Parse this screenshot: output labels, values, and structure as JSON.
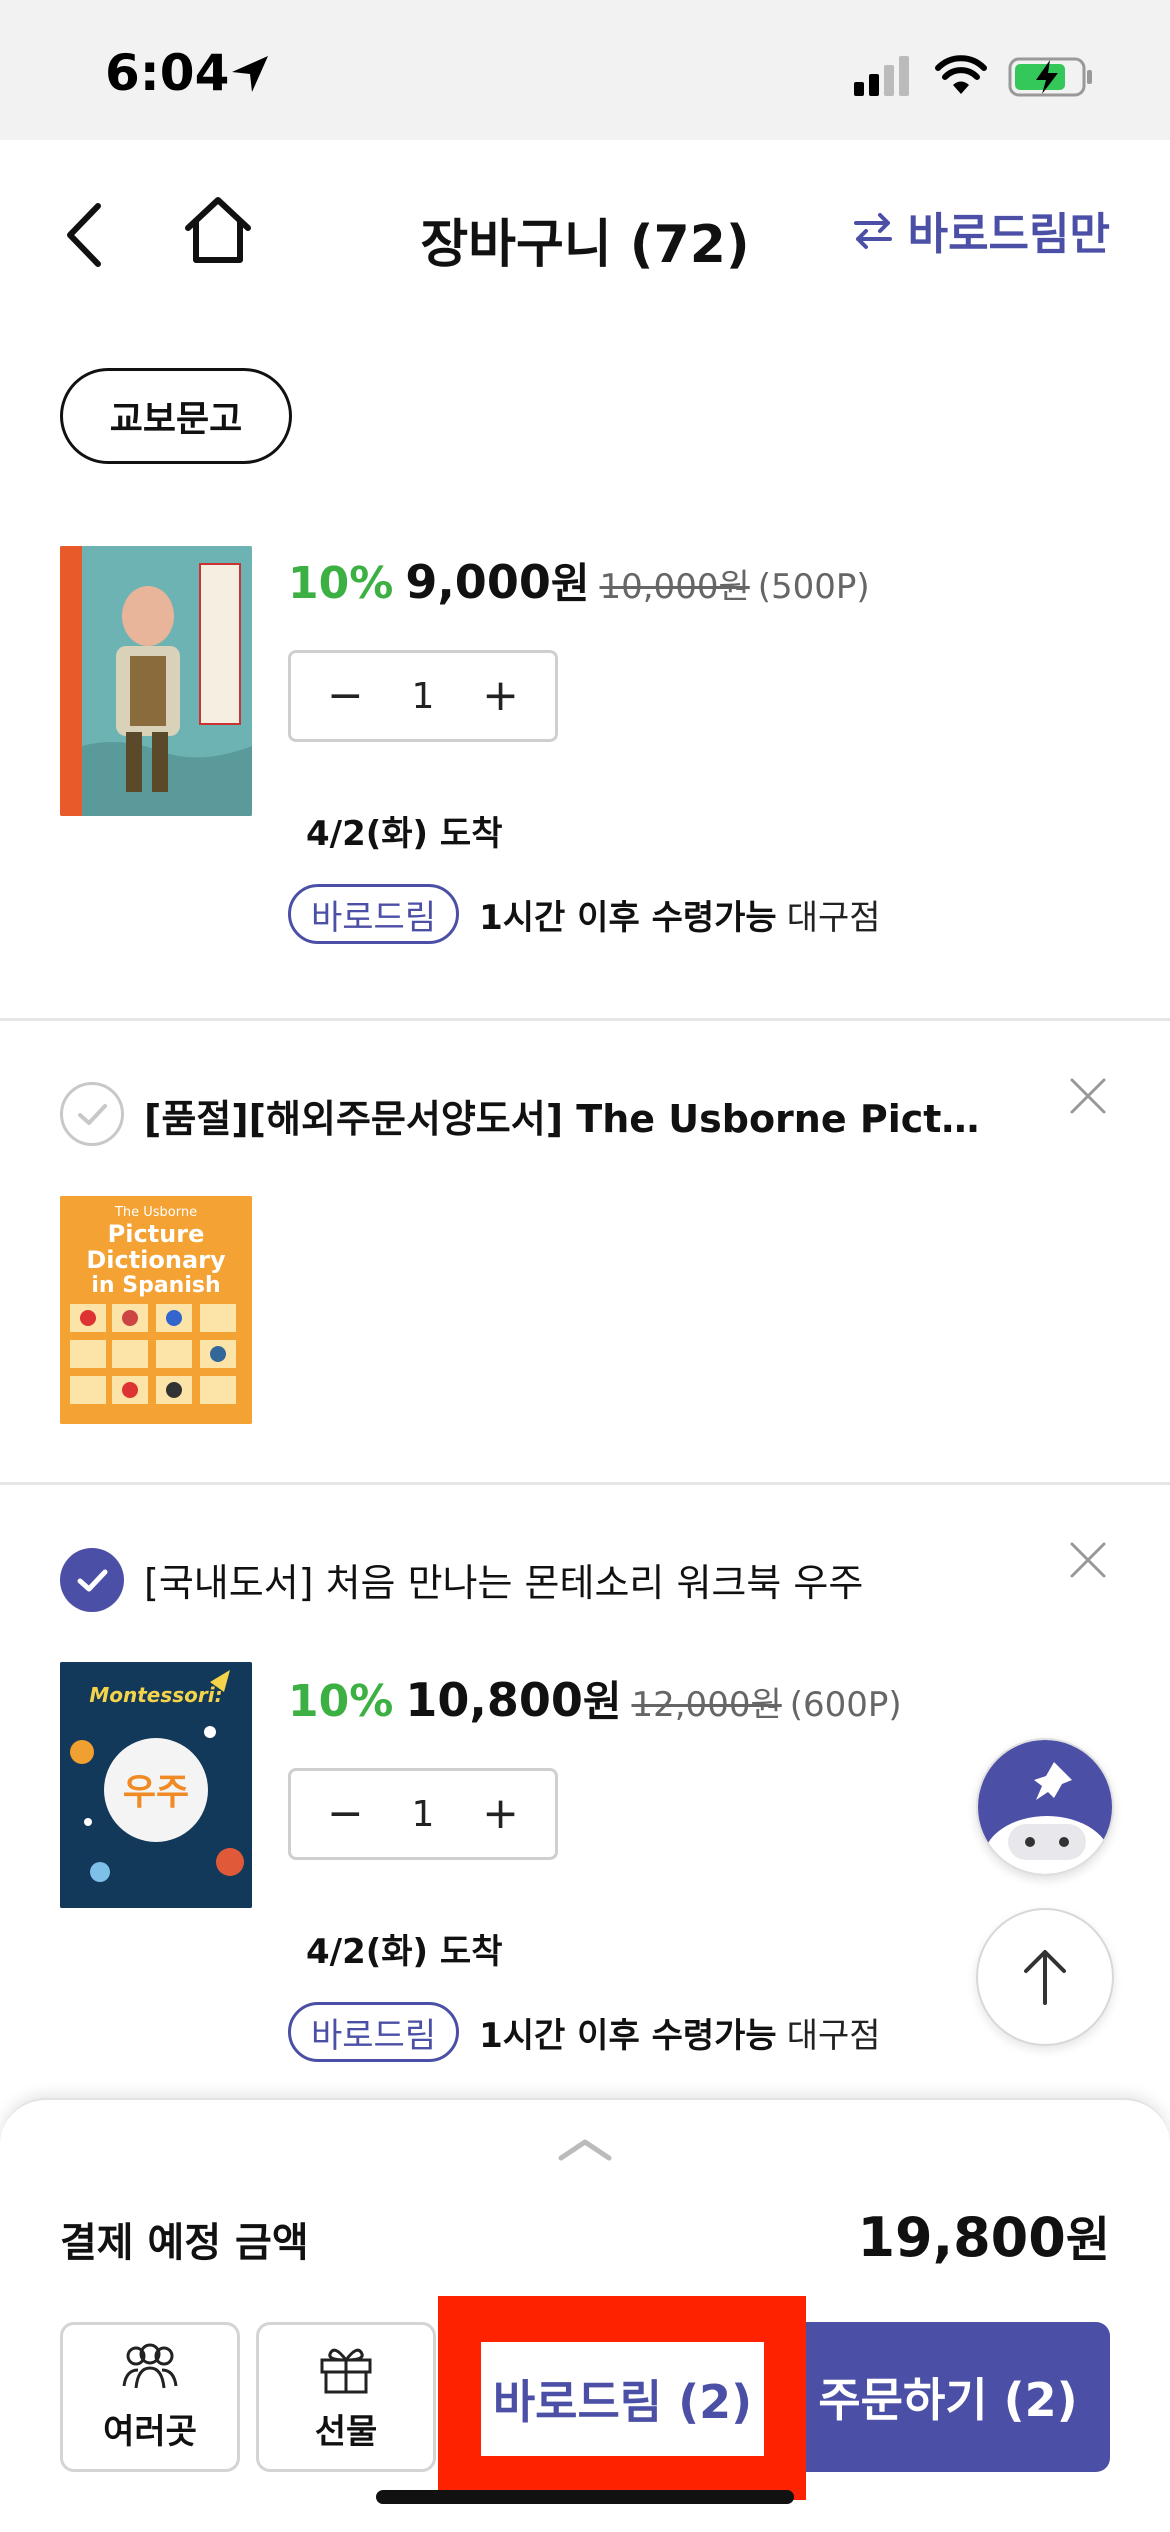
{
  "status_bar": {
    "time": "6:04"
  },
  "nav": {
    "title": "장바구니 (72)",
    "baro_only_label": "바로드림만"
  },
  "store_chip": "교보문고",
  "items": [
    {
      "title": "",
      "discount": "10%",
      "price": "9,000",
      "price_unit": "원",
      "original_price": "10,000원",
      "points": "(500P)",
      "quantity": "1",
      "arrival": "4/2(화) 도착",
      "baro_badge": "바로드림",
      "pickup_time": "1시간 이후 수령가능",
      "pickup_store": "대구점"
    },
    {
      "title": "[품절][해외주문서양도서] The Usborne Picture ...",
      "checked": false
    },
    {
      "title": "[국내도서] 처음 만나는 몬테소리 워크북 우주",
      "checked": true,
      "discount": "10%",
      "price": "10,800",
      "price_unit": "원",
      "original_price": "12,000원",
      "points": "(600P)",
      "quantity": "1",
      "arrival": "4/2(화) 도착",
      "baro_badge": "바로드림",
      "pickup_time": "1시간 이후 수령가능",
      "pickup_store": "대구점"
    }
  ],
  "book_covers": {
    "book2": {
      "line1": "The Usborne",
      "line2": "Picture",
      "line3": "Dictionary",
      "line4": "in Spanish"
    },
    "book3": {
      "top": "Montessori:",
      "main": "우주"
    }
  },
  "summary": {
    "label": "결제 예정 금액",
    "amount": "19,800",
    "unit": "원"
  },
  "actions": {
    "multi_address": "여러곳",
    "gift": "선물",
    "baro_button": "바로드림 (2)",
    "order_button": "주문하기 (2)"
  },
  "colors": {
    "accent": "#4b4fa6",
    "discount": "#3cb043",
    "highlight": "#ff2200"
  }
}
